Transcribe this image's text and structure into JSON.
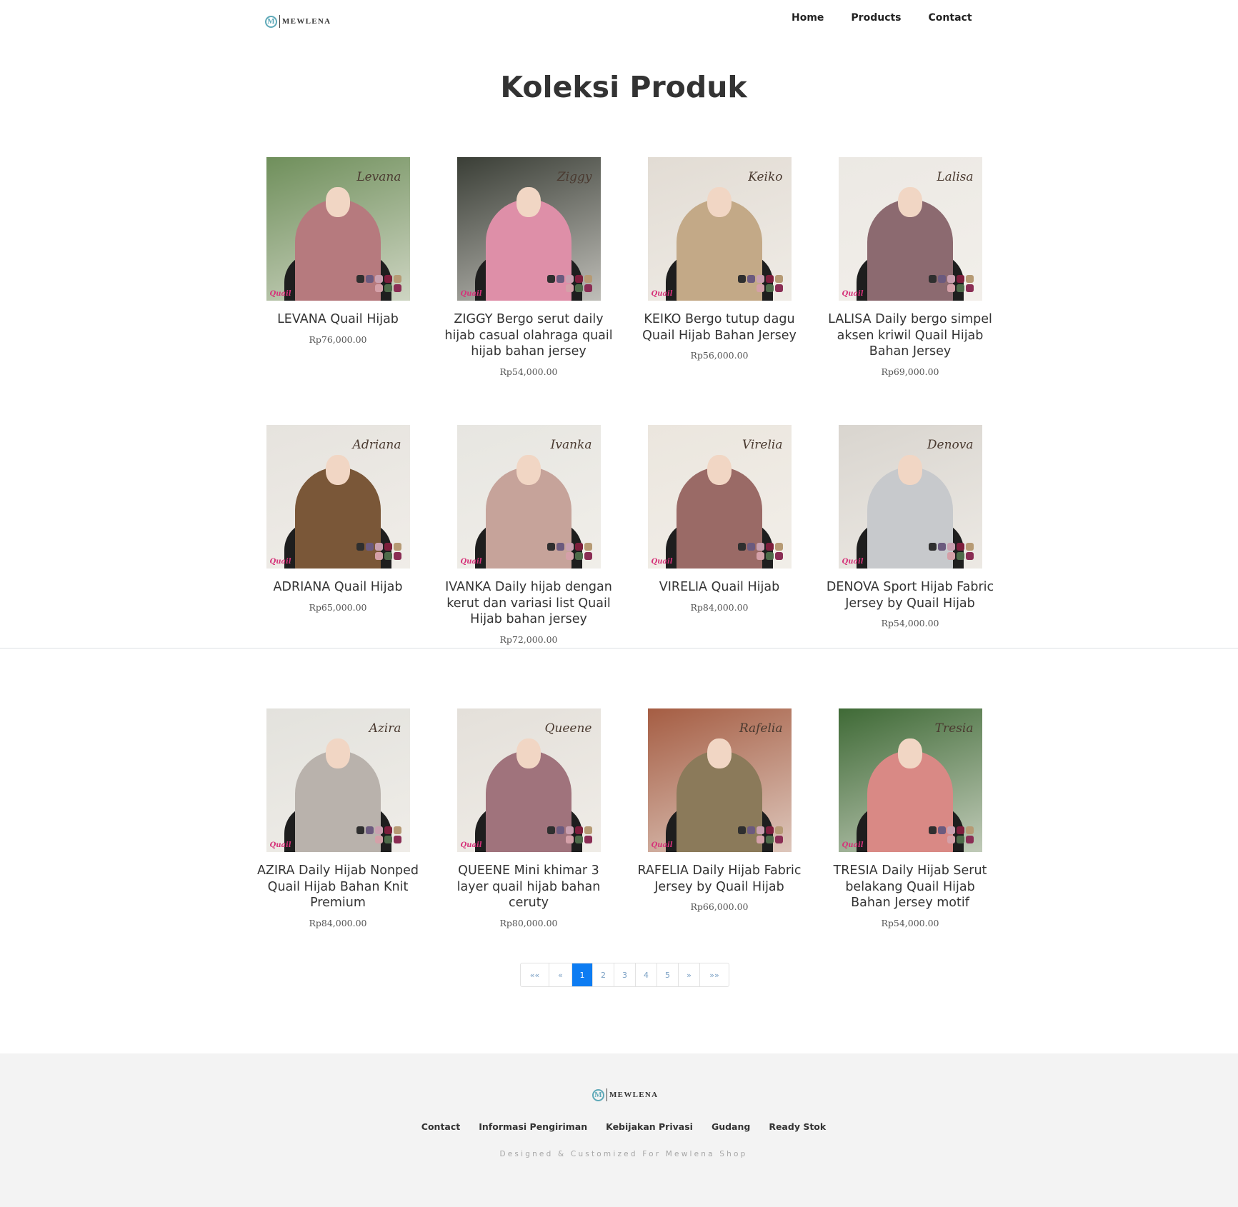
{
  "header": {
    "logo_text": "MEWLENA",
    "logo_mark": "M",
    "nav": [
      "Home",
      "Products",
      "Contact"
    ]
  },
  "page_title": "Koleksi Produk",
  "products": [
    {
      "name": "LEVANA Quail Hijab",
      "price": "Rp76,000.00",
      "script": "Levana",
      "hijab_color": "#b67a7e",
      "bg": "#6f8f5b"
    },
    {
      "name": "ZIGGY Bergo serut daily hijab casual olahraga quail hijab bahan jersey",
      "price": "Rp54,000.00",
      "script": "Ziggy",
      "hijab_color": "#de8fa8",
      "bg": "#3a3e36"
    },
    {
      "name": "KEIKO Bergo tutup dagu Quail Hijab Bahan Jersey",
      "price": "Rp56,000.00",
      "script": "Keiko",
      "hijab_color": "#c3a987",
      "bg": "#e2dcd4"
    },
    {
      "name": "LALISA Daily bergo simpel aksen kriwil Quail Hijab Bahan Jersey",
      "price": "Rp69,000.00",
      "script": "Lalisa",
      "hijab_color": "#8c6a70",
      "bg": "#ece9e4"
    },
    {
      "name": "ADRIANA Quail Hijab",
      "price": "Rp65,000.00",
      "script": "Adriana",
      "hijab_color": "#7a5738",
      "bg": "#e6e3de"
    },
    {
      "name": "IVANKA Daily hijab dengan kerut dan variasi list Quail Hijab bahan jersey",
      "price": "Rp72,000.00",
      "script": "Ivanka",
      "hijab_color": "#c6a39a",
      "bg": "#e7e6e1"
    },
    {
      "name": "VIRELIA Quail Hijab",
      "price": "Rp84,000.00",
      "script": "Virelia",
      "hijab_color": "#9a6a66",
      "bg": "#ebe6de"
    },
    {
      "name": "DENOVA Sport Hijab Fabric Jersey by Quail Hijab",
      "price": "Rp54,000.00",
      "script": "Denova",
      "hijab_color": "#c7c9cc",
      "bg": "#d9d5cf"
    },
    {
      "name": "AZIRA Daily Hijab Nonped Quail Hijab Bahan Knit Premium",
      "price": "Rp84,000.00",
      "script": "Azira",
      "hijab_color": "#b9b2ac",
      "bg": "#e3e2dd"
    },
    {
      "name": "QUEENE Mini khimar 3 layer quail hijab bahan ceruty",
      "price": "Rp80,000.00",
      "script": "Queene",
      "hijab_color": "#a0737c",
      "bg": "#e4e0da"
    },
    {
      "name": "RAFELIA Daily Hijab Fabric Jersey by Quail Hijab",
      "price": "Rp66,000.00",
      "script": "Rafelia",
      "hijab_color": "#8b7a5a",
      "bg": "#a55d43"
    },
    {
      "name": "TRESIA Daily Hijab Serut belakang Quail Hijab Bahan Jersey motif",
      "price": "Rp54,000.00",
      "script": "Tresia",
      "hijab_color": "#d98985",
      "bg": "#3f6a36"
    }
  ],
  "product_brand_label": "Quail",
  "swatch_colors": [
    "#2f2f2f",
    "#6b5a7e",
    "#c9a0b0",
    "#7d1e3c",
    "#b69a74",
    "#d4a0a8",
    "#4e6b4a",
    "#8a2d54"
  ],
  "pagination": {
    "items": [
      "««",
      "«",
      "1",
      "2",
      "3",
      "4",
      "5",
      "»",
      "»»"
    ],
    "active": "1",
    "active_color": "#0d7cf2"
  },
  "footer": {
    "logo_text": "MEWLENA",
    "logo_mark": "M",
    "links": [
      "Contact",
      "Informasi Pengiriman",
      "Kebijakan Privasi",
      "Gudang",
      "Ready Stok"
    ],
    "credit": "Designed & Customized For Mewlena Shop"
  }
}
